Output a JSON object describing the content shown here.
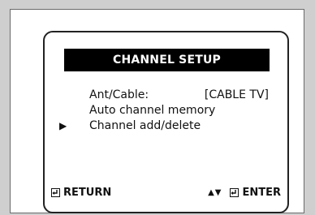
{
  "title": "CHANNEL SETUP",
  "menu": [
    {
      "label": "Ant/Cable:",
      "value": "[CABLE TV]",
      "selected": false
    },
    {
      "label": "Auto channel memory",
      "value": "",
      "selected": false
    },
    {
      "label": "Channel add/delete",
      "value": "",
      "selected": true
    }
  ],
  "cursor_symbol": "▶",
  "footer": {
    "return_icon": "return-key-icon",
    "return_label": "RETURN",
    "nav_symbol": "▲▼",
    "enter_icon": "enter-key-icon",
    "enter_label": "ENTER"
  }
}
